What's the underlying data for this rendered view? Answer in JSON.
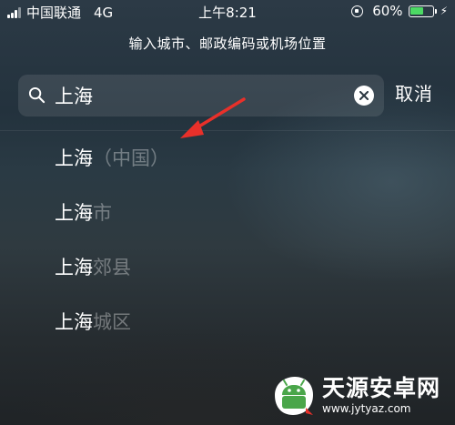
{
  "status_bar": {
    "carrier": "中国联通",
    "network": "4G",
    "time": "上午8:21",
    "battery_percent": "60%",
    "battery_level": 0.6,
    "battery_color": "#4cd964"
  },
  "prompt": "输入城市、邮政编码或机场位置",
  "search": {
    "value": "上海",
    "cancel_label": "取消"
  },
  "results": [
    {
      "match": "上海",
      "rest": "（中国）"
    },
    {
      "match": "上海",
      "rest": "市"
    },
    {
      "match": "上海",
      "rest": "郊县"
    },
    {
      "match": "上海",
      "rest": "城区"
    }
  ],
  "annotation": {
    "color": "#e8302a"
  },
  "watermark": {
    "title": "天源安卓网",
    "url": "www.jytyaz.com"
  }
}
